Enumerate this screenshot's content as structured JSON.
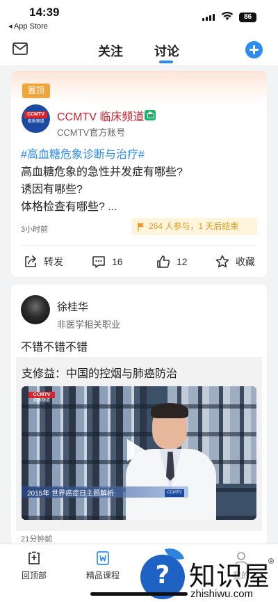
{
  "status_bar": {
    "time": "14:39",
    "back_app": "◂ App Store",
    "battery": "86"
  },
  "nav": {
    "tabs": [
      "关注",
      "讨论"
    ],
    "active_tab": "讨论",
    "accent_color": "#2d8cf0"
  },
  "card1": {
    "badge": "置顶",
    "logo_text_top": "CCMTV",
    "logo_text_bottom": "临床频道",
    "account_name": "CCMTV 临床频道",
    "account_sub": "CCMTV官方账号",
    "topic": "#高血糖危象诊断与治疗#",
    "lines": [
      "高血糖危象的急性并发症有哪些?",
      "诱因有哪些?",
      "体格检查有哪些? ..."
    ],
    "time_ago": "3小时前",
    "participation": "264 人参与，1 天后结束",
    "actions": {
      "share": "转发",
      "comments": "16",
      "likes": "12",
      "favorite": "收藏"
    }
  },
  "card2": {
    "user_name": "徐桂华",
    "user_sub": "非医学相关职业",
    "post_text": "不错不错不错",
    "share_title": "支修益：中国的控烟与肺癌防治",
    "video_logo_top": "CCMTV",
    "video_logo_bottom": "临床频道",
    "video_caption": "2015年 世界癌症日主题解析",
    "video_corner": "CCMTV",
    "time_ago": "21分钟前"
  },
  "bottom_nav": {
    "items": [
      "回顶部",
      "精品课程",
      "我的"
    ]
  },
  "watermark": {
    "title": "知识屋",
    "registered": "®",
    "url": "zhishiwu.com"
  }
}
